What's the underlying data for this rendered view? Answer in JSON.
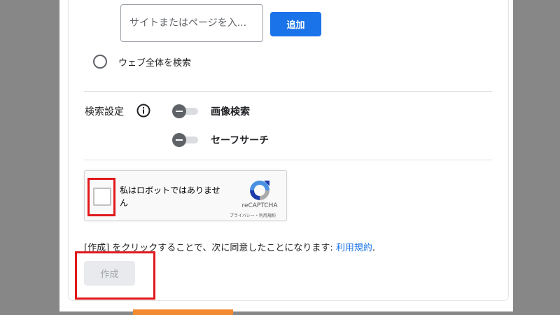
{
  "site_search": {
    "input_placeholder": "サイトまたはページを入...",
    "add_label": "追加"
  },
  "search_scope": {
    "whole_web_label": "ウェブ全体を検索"
  },
  "search_settings": {
    "label": "検索設定",
    "info_icon": "info-icon",
    "toggles": [
      {
        "label": "画像検索",
        "on": false
      },
      {
        "label": "セーフサーチ",
        "on": false
      }
    ]
  },
  "recaptcha": {
    "text": "私はロボットではありません",
    "brand": "reCAPTCHA",
    "links": "プライバシー・利用規約"
  },
  "terms": {
    "text": "[作成] をクリックすることで、次に同意したことになります: ",
    "link_label": "利用規約",
    "period": "."
  },
  "create_label": "作成",
  "colors": {
    "primary": "#1a73e8",
    "highlight": "#e0191d",
    "backdrop": "#878787"
  }
}
